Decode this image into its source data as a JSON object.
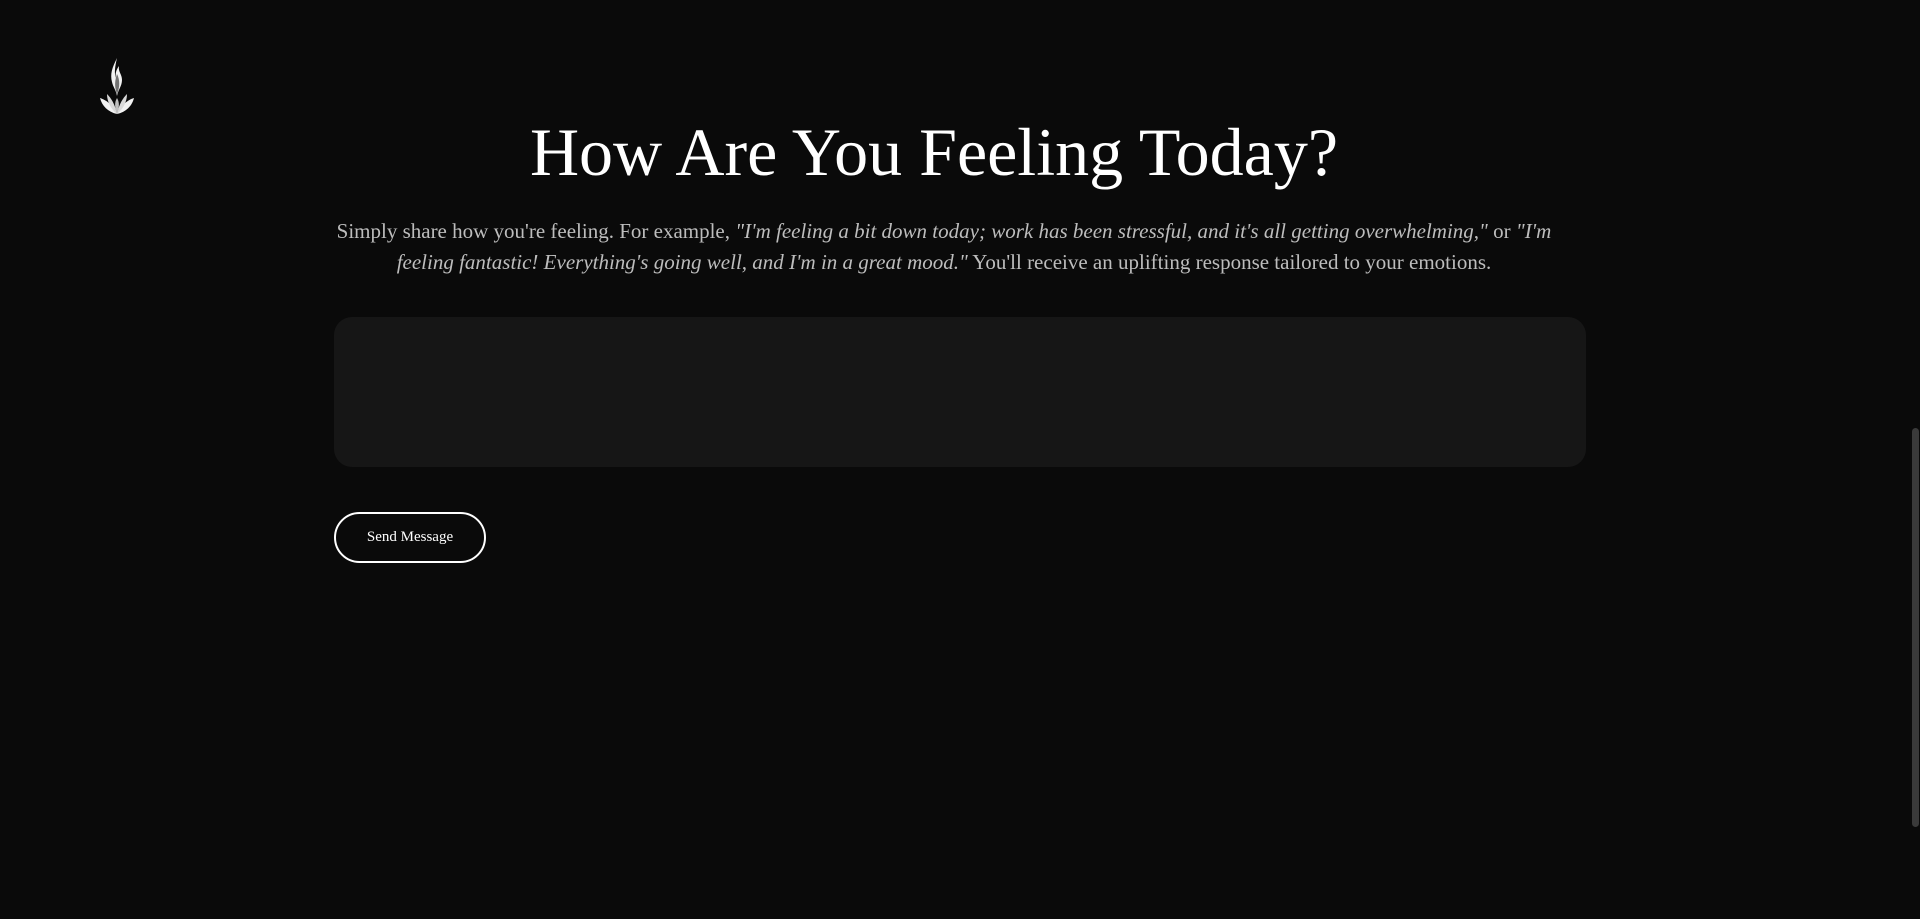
{
  "brand": {
    "logo_icon": "flame-icon"
  },
  "header": {
    "title": "How Are You Feeling Today?"
  },
  "intro": {
    "lead": "Simply share how you're feeling. For example, ",
    "example_one": "\"I'm feeling a bit down today; work has been stressful, and it's all getting overwhelming,\"",
    "connector": " or ",
    "example_two": "\"I'm feeling fantastic! Everything's going well, and I'm in a great mood.\"",
    "outro": " You'll receive an uplifting response tailored to your emotions."
  },
  "form": {
    "message_value": "",
    "message_placeholder": "",
    "send_label": "Send Message"
  },
  "theme": {
    "background": "#0a0a0a",
    "input_background": "#161616",
    "text_primary": "#ffffff",
    "text_secondary": "#bdbdbd"
  }
}
